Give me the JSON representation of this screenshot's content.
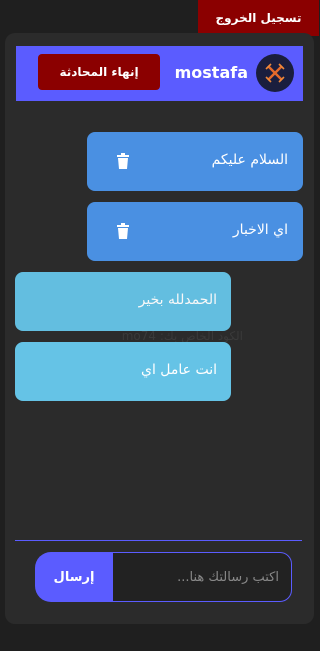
{
  "top": {
    "logout_label": "تسجيل الخروج"
  },
  "header": {
    "username": "mostafa",
    "end_chat_label": "إنهاء المحادثة",
    "avatar_icon": "crossed-swords-icon"
  },
  "messages": [
    {
      "side": "sent",
      "text": "السلام عليكم",
      "icon": "trash-icon"
    },
    {
      "side": "sent",
      "text": "اي الاخبار",
      "icon": "trash-icon"
    },
    {
      "side": "recv",
      "text": "الحمدلله بخير"
    },
    {
      "side": "recv",
      "text": "انت عامل اي"
    }
  ],
  "watermark": {
    "text": "الكود الخاص بك: mo74"
  },
  "composer": {
    "placeholder": "اكتب رسالتك هنا...",
    "send_label": "إرسال"
  },
  "colors": {
    "accent": "#5b5cff",
    "danger": "#8b0000",
    "sent_bubble": "#4a90e2",
    "received_bubble": "#65c3e6"
  }
}
